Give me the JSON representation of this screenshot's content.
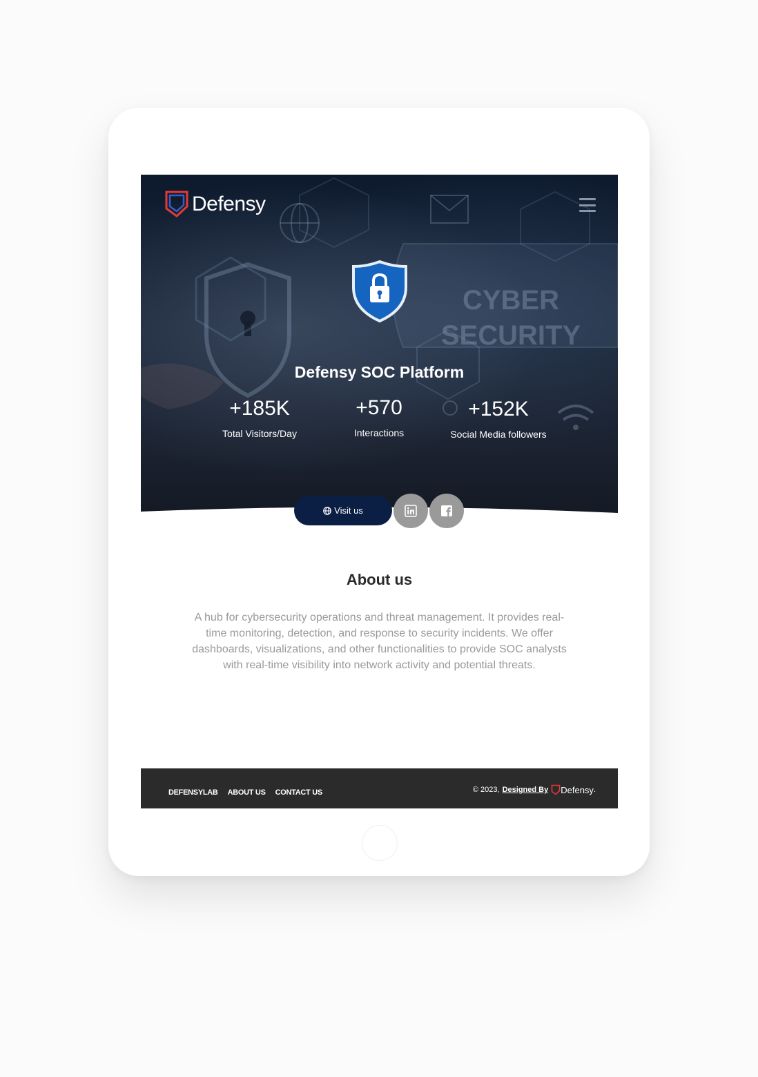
{
  "header": {
    "logo_text": "Defensy"
  },
  "hero": {
    "watermark_line1": "CYBER",
    "watermark_line2": "SECURITY",
    "title": "Defensy SOC Platform",
    "stats": [
      {
        "value": "+185K",
        "label": "Total Visitors/Day"
      },
      {
        "value": "+570",
        "label": "Interactions"
      },
      {
        "value": "+152K",
        "label": "Social Media followers"
      }
    ],
    "visit_label": "Visit us"
  },
  "about": {
    "title": "About us",
    "lines": [
      "A hub for cybersecurity operations and threat management. It provides real-",
      "time monitoring, detection, and response to security incidents. We offer",
      "dashboards, visualizations, and other functionalities to provide SOC analysts",
      "with real-time visibility into network activity and potential threats."
    ]
  },
  "footer": {
    "links": [
      "DEFENSYLAB",
      "ABOUT US",
      "CONTACT US"
    ],
    "copyright": "© 2023,",
    "designed_by": "Designed By",
    "brand": "Defensy",
    "brand_suffix": "."
  },
  "colors": {
    "hero_dark": "#0d1a2e",
    "button_navy": "#0b1f44",
    "shield_blue": "#1565c0",
    "logo_red": "#e53935",
    "footer_bg": "#2b2b2b",
    "social_gray": "#9a9a9a"
  }
}
